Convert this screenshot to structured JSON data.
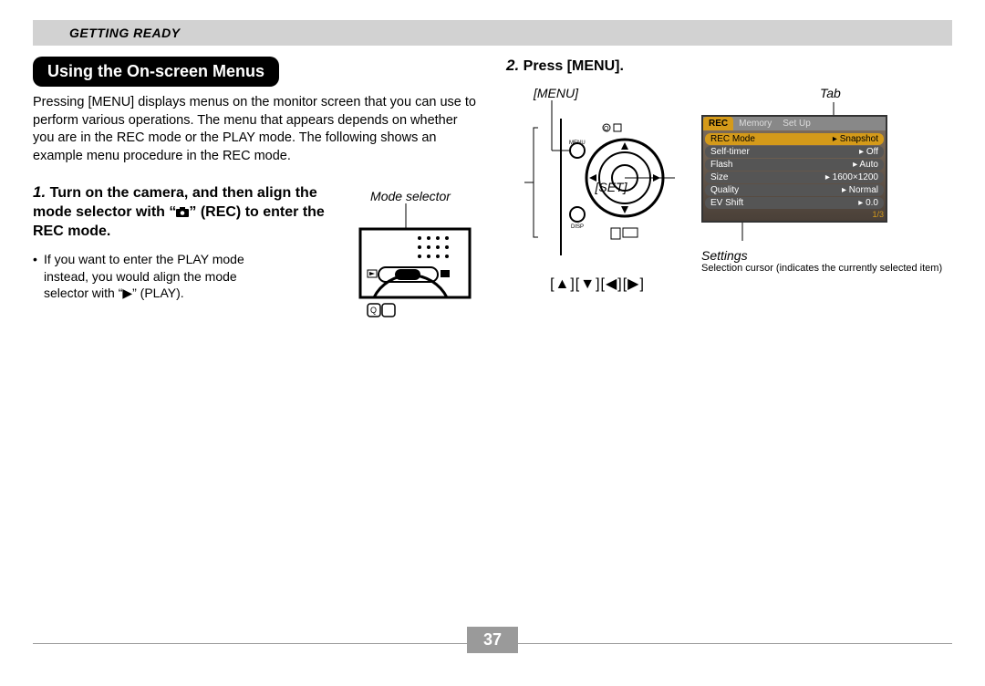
{
  "header": {
    "section": "GETTING READY"
  },
  "left": {
    "heading": "Using the On-screen Menus",
    "paragraph": "Pressing [MENU] displays menus on the monitor screen that you can use to perform various operations. The menu that appears depends on whether you are in the REC mode or the PLAY mode. The following shows an example menu procedure in the REC mode.",
    "step1_num": "1.",
    "step1_text_before": "Turn on the camera, and then align the mode selector with “",
    "step1_text_after": "” (REC) to enter the REC mode.",
    "step1_icon_name": "camera-icon",
    "step1_bullet": "If you want to enter the PLAY mode instead, you would align the mode selector with “▶” (PLAY).",
    "mode_selector_label": "Mode selector"
  },
  "right": {
    "step2_num": "2.",
    "step2_text": "Press [MENU].",
    "menu_label": "[MENU]",
    "set_label": "[SET]",
    "arrows": "[▲][▼][◀][▶]",
    "tab_label": "Tab",
    "settings_label": "Settings",
    "settings_note": "Selection cursor (indicates the currently selected item)",
    "screen": {
      "tabs": [
        "REC",
        "Memory",
        "Set Up"
      ],
      "rows": [
        {
          "name": "REC Mode",
          "value": "Snapshot",
          "selected": true
        },
        {
          "name": "Self-timer",
          "value": "Off"
        },
        {
          "name": "Flash",
          "value": "Auto"
        },
        {
          "name": "Size",
          "value": "1600×1200"
        },
        {
          "name": "Quality",
          "value": "Normal"
        },
        {
          "name": "EV Shift",
          "value": "0.0"
        }
      ],
      "page_indicator": "1/3"
    }
  },
  "page_number": "37"
}
